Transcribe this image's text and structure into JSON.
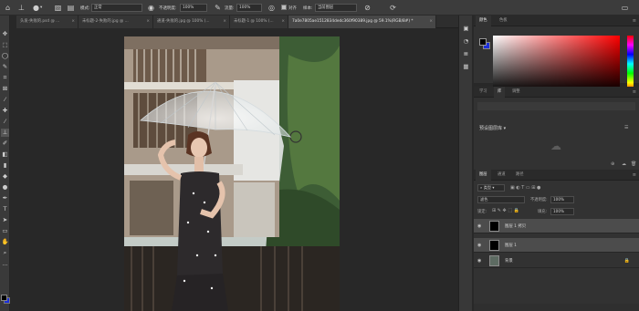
{
  "options_bar": {
    "mode_label": "模式:",
    "mode_value": "正常",
    "opacity_label": "不透明度:",
    "opacity_value": "100%",
    "flow_label": "流量:",
    "flow_value": "100%",
    "align_label": "对齐",
    "sample_label": "样本:",
    "sample_value": "当前图层"
  },
  "tabs": [
    {
      "label": "头发-失败的.psd @ ..."
    },
    {
      "label": "未标题-2-失败的.jpg @ ..."
    },
    {
      "label": "通道-失败的.jpg @ 100% (..."
    },
    {
      "label": "未标题-1 @ 100% (..."
    },
    {
      "label": "7a0e7805ae1512834dedc360f90389.jpg @ 59.1%(RGB/8#) *"
    }
  ],
  "close_glyph": "×",
  "color_panel": {
    "tabs": [
      "颜色",
      "色板"
    ],
    "fg_color": "#000000",
    "bg_color": "#1c2fd9"
  },
  "learn_panel": {
    "tabs": [
      "学习",
      "库",
      "调整"
    ],
    "preset": "预设图层库"
  },
  "layers_panel": {
    "tabs": [
      "图层",
      "通道",
      "路径"
    ],
    "filter_label": "类型",
    "blend_mode": "滤色",
    "opacity_label": "不透明度:",
    "opacity_value": "100%",
    "lock_label": "锁定:",
    "fill_label": "填充:",
    "fill_value": "100%",
    "layers": [
      {
        "name": "图层 1 拷贝",
        "selected": true
      },
      {
        "name": "图层 1",
        "selected": true
      },
      {
        "name": "背景",
        "selected": false
      }
    ]
  }
}
